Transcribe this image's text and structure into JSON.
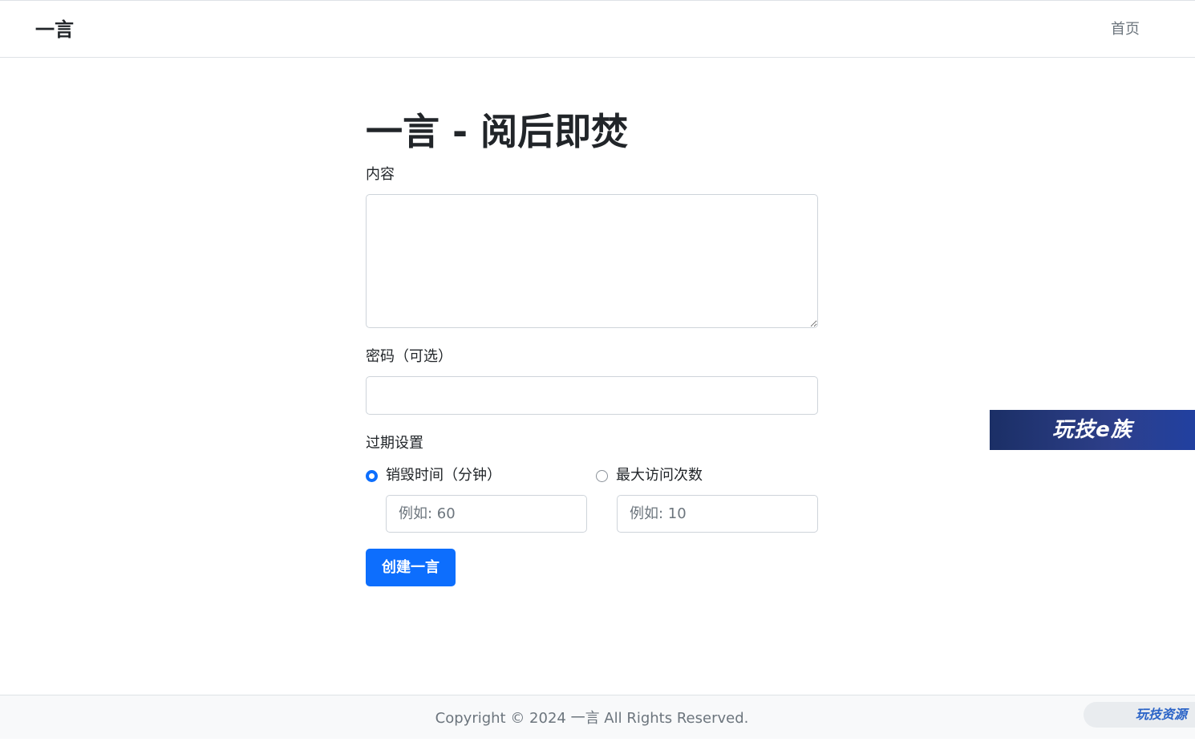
{
  "navbar": {
    "brand": "一言",
    "home_link": "首页"
  },
  "form": {
    "title": "一言 - 阅后即焚",
    "content_label": "内容",
    "content_value": "",
    "password_label": "密码（可选）",
    "password_value": "",
    "expiry_label": "过期设置",
    "expiry_options": [
      {
        "label": "销毁时间（分钟）",
        "checked": true,
        "placeholder": "例如: 60"
      },
      {
        "label": "最大访问次数",
        "checked": false,
        "placeholder": "例如: 10"
      }
    ],
    "submit_label": "创建一言"
  },
  "side_banner": {
    "text": "玩技e族"
  },
  "footer": {
    "copyright": "Copyright © 2024 一言 All Rights Reserved.",
    "badge": "玩技资源"
  },
  "colors": {
    "primary": "#0d6efd",
    "muted": "#6c757d",
    "border": "#ced4da",
    "banner": "#2d3f8a"
  }
}
